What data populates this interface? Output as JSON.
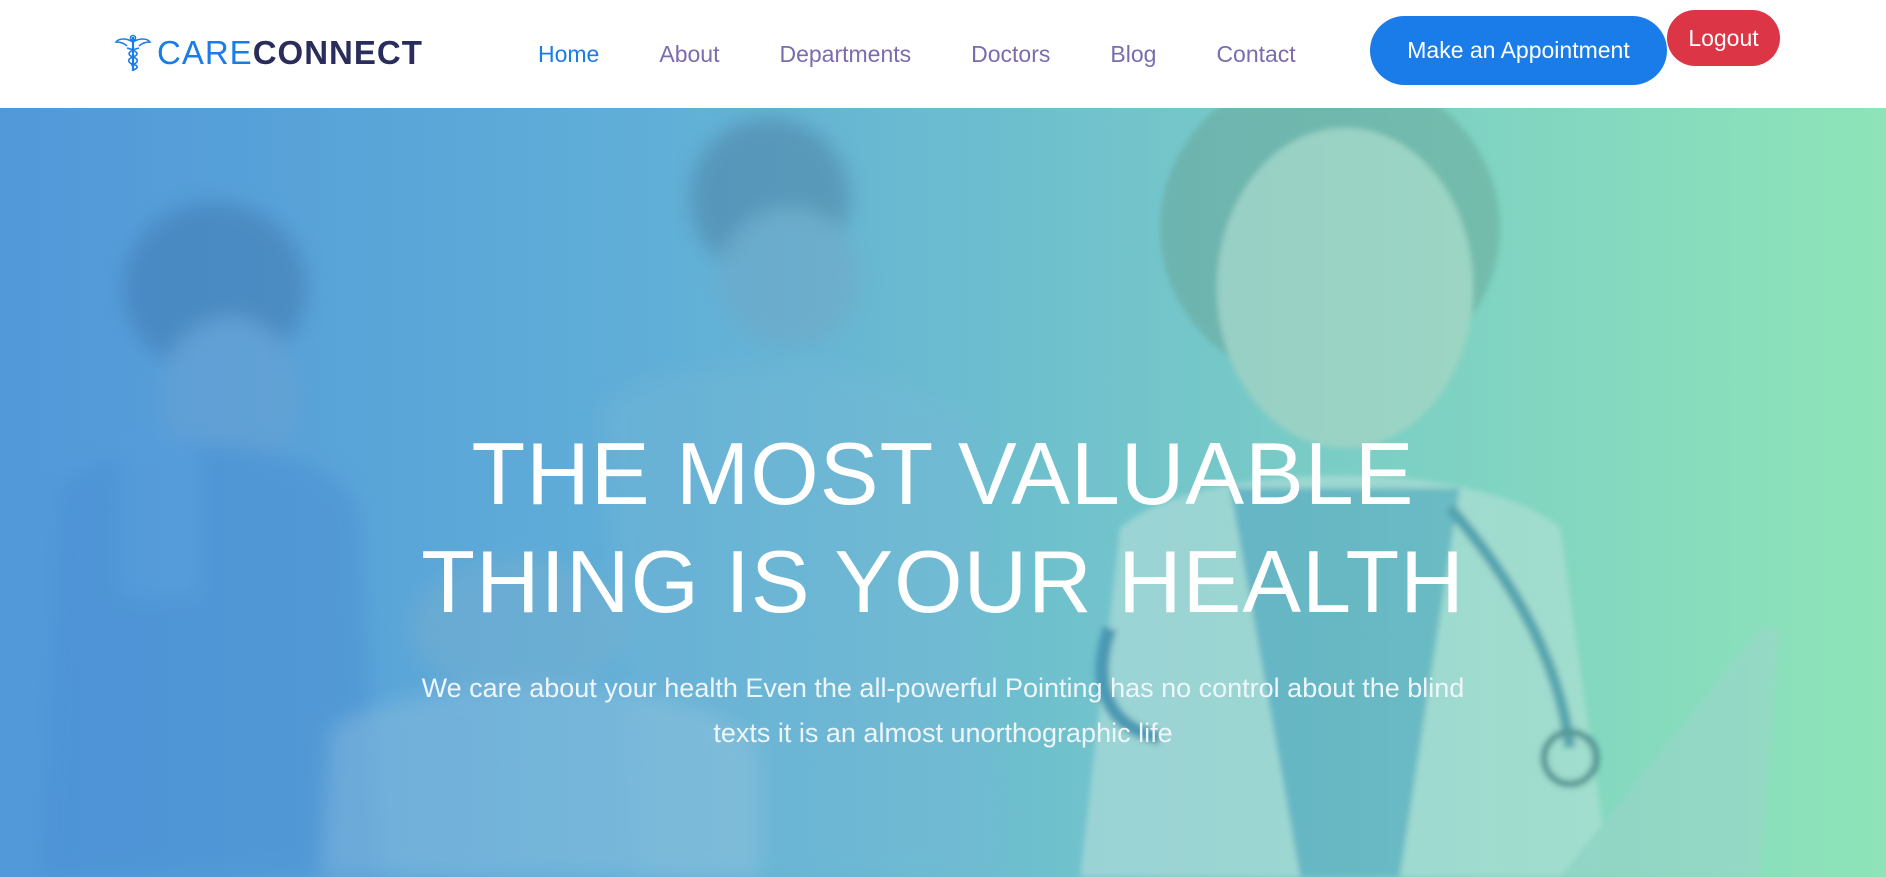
{
  "brand": {
    "name_part1": "CARE",
    "name_part2": "CONNECT",
    "icon": "caduceus-icon"
  },
  "nav": {
    "items": [
      {
        "label": "Home",
        "active": true
      },
      {
        "label": "About",
        "active": false
      },
      {
        "label": "Departments",
        "active": false
      },
      {
        "label": "Doctors",
        "active": false
      },
      {
        "label": "Blog",
        "active": false
      },
      {
        "label": "Contact",
        "active": false
      }
    ],
    "appointment_label": "Make an Appointment",
    "logout_label": "Logout"
  },
  "hero": {
    "title_line1": "THE MOST VALUABLE",
    "title_line2": "THING IS YOUR HEALTH",
    "subtitle": "We care about your health Even the all-powerful Pointing has no control about the blind texts it is an almost unorthographic life",
    "background": "medical-staff-photo"
  },
  "colors": {
    "primary": "#1a7ce8",
    "brand_dark": "#2a2d5c",
    "nav_text": "#7a6cae",
    "logout": "#dc3545",
    "hero_gradient_start": "#5a9fd8",
    "hero_gradient_end": "#8fe3b8"
  }
}
